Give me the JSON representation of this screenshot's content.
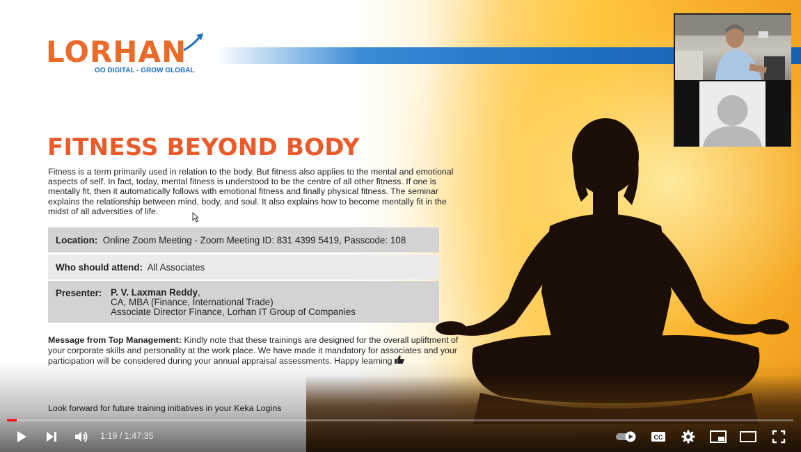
{
  "slide": {
    "logo_word": "LORHAN",
    "logo_tagline": "GO DIGITAL - GROW GLOBAL",
    "title": "FITNESS BEYOND BODY",
    "intro": "Fitness is a term primarily used in relation to the body. But fitness also applies to the mental and emotional aspects of self. In fact, today, mental fitness is understood to be the centre of all other fitness. If one is mentally fit, then it automatically follows with emotional fitness and finally physical fitness. The seminar explains the relationship between mind, body, and soul. It also explains how to become mentally fit in the midst of all adversities of life.",
    "location_label": "Location:",
    "location_value": "Online Zoom Meeting - Zoom Meeting ID: 831 4399 5419, Passcode: 108",
    "attend_label": "Who should attend:",
    "attend_value": "All Associates",
    "presenter_label": "Presenter:",
    "presenter_name": "P. V. Laxman Reddy",
    "presenter_name_suffix": ",",
    "presenter_line2": "CA, MBA (Finance, International Trade)",
    "presenter_line3": "Associate Director Finance, Lorhan IT Group of Companies",
    "message_label": "Message from Top Management:",
    "message_text": "Kindly note that these trainings are designed for the overall upliftment of your corporate skills and personality at the work place. We have made it mandatory for associates and your participation will be considered during your annual appraisal assessments. Happy learning",
    "footer_note": "Look forward for future training initiatives in your Keka Logins"
  },
  "player": {
    "current_time": "1:19",
    "duration": "1:47:35",
    "time_separator": " / ",
    "progress_fraction": 0.0122,
    "accent_color": "#ff0000"
  },
  "icons": [
    "play-icon",
    "next-icon",
    "volume-icon",
    "autoplay-toggle-icon",
    "captions-icon",
    "settings-icon",
    "miniplayer-icon",
    "theater-mode-icon",
    "fullscreen-icon",
    "thumbs-up-icon"
  ]
}
